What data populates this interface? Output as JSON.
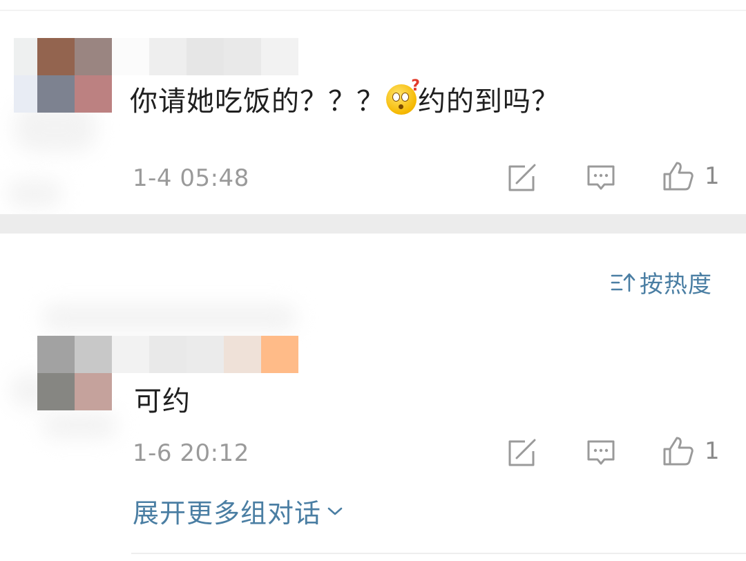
{
  "comments": [
    {
      "text_before_emoji": "你请她吃饭的？？？",
      "emoji": "thinking-face-icon",
      "text_after_emoji": "约的到吗？",
      "time": "1-4 05:48",
      "likes": "1"
    },
    {
      "text": "可约",
      "time": "1-6 20:12",
      "likes": "1"
    }
  ],
  "sort": {
    "icon": "sort-icon",
    "label": "按热度"
  },
  "expand": {
    "label": "展开更多组对话",
    "icon": "chevron-down-icon"
  },
  "colors": {
    "link": "#4a7ea3",
    "meta": "#9a9a9a",
    "divider": "#ececec"
  }
}
